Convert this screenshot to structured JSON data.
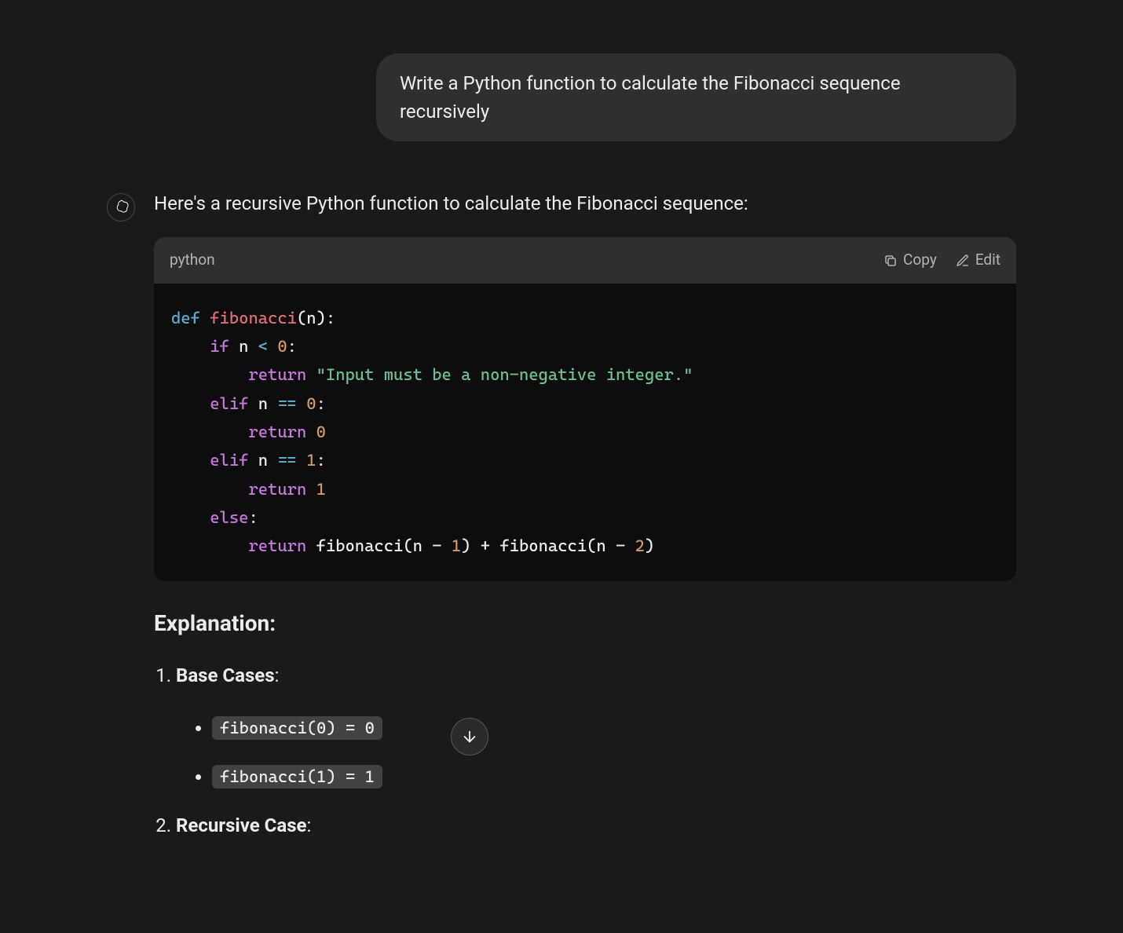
{
  "user_message": "Write a Python function to calculate the Fibonacci sequence recursively",
  "assistant_intro": "Here's a recursive Python function to calculate the Fibonacci sequence:",
  "code_block": {
    "language": "python",
    "copy_label": "Copy",
    "edit_label": "Edit",
    "tokens": [
      [
        [
          "def ",
          "kw-def"
        ],
        [
          "fibonacci",
          "fn-name"
        ],
        [
          "(",
          "paren"
        ],
        [
          "n",
          "var"
        ],
        [
          ")",
          "paren"
        ],
        [
          ":",
          "punct"
        ]
      ],
      [
        [
          "    ",
          ""
        ],
        [
          "if ",
          "kw-if"
        ],
        [
          "n ",
          "var"
        ],
        [
          "< ",
          "op"
        ],
        [
          "0",
          "num"
        ],
        [
          ":",
          "punct"
        ]
      ],
      [
        [
          "        ",
          ""
        ],
        [
          "return ",
          "kw-return"
        ],
        [
          "\"Input must be a non-negative integer.\"",
          "str"
        ]
      ],
      [
        [
          "    ",
          ""
        ],
        [
          "elif ",
          "kw-elif"
        ],
        [
          "n ",
          "var"
        ],
        [
          "== ",
          "op"
        ],
        [
          "0",
          "num"
        ],
        [
          ":",
          "punct"
        ]
      ],
      [
        [
          "        ",
          ""
        ],
        [
          "return ",
          "kw-return"
        ],
        [
          "0",
          "num"
        ]
      ],
      [
        [
          "    ",
          ""
        ],
        [
          "elif ",
          "kw-elif"
        ],
        [
          "n ",
          "var"
        ],
        [
          "== ",
          "op"
        ],
        [
          "1",
          "num"
        ],
        [
          ":",
          "punct"
        ]
      ],
      [
        [
          "        ",
          ""
        ],
        [
          "return ",
          "kw-return"
        ],
        [
          "1",
          "num"
        ]
      ],
      [
        [
          "    ",
          ""
        ],
        [
          "else",
          "kw-else"
        ],
        [
          ":",
          "punct"
        ]
      ],
      [
        [
          "        ",
          ""
        ],
        [
          "return ",
          "kw-return"
        ],
        [
          "fibonacci(n - ",
          "var"
        ],
        [
          "1",
          "num"
        ],
        [
          ") + fibonacci(n - ",
          "var"
        ],
        [
          "2",
          "num"
        ],
        [
          ")",
          "var"
        ]
      ]
    ]
  },
  "explanation": {
    "title": "Explanation:",
    "items": [
      {
        "number": "1.",
        "title": "Base Cases",
        "bullets": [
          "fibonacci(0) = 0",
          "fibonacci(1) = 1"
        ]
      },
      {
        "number": "2.",
        "title": "Recursive Case",
        "bullets": []
      }
    ]
  }
}
